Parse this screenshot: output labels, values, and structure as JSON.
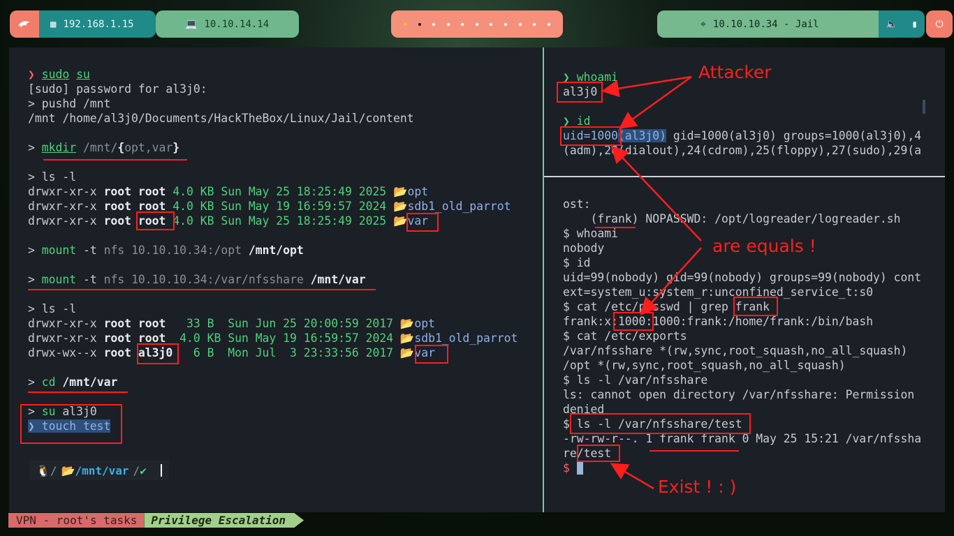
{
  "topbar": {
    "lan_ip": "192.168.1.15",
    "vpn_ip": "10.10.14.14",
    "target": "10.10.10.34 - Jail",
    "workspaces": [
      true,
      true,
      false,
      false,
      false,
      false,
      false,
      false,
      false,
      false,
      false
    ]
  },
  "left_pane": {
    "lines": [
      {
        "segs": [
          [
            "pink",
            "❯ "
          ],
          [
            "g u",
            "sudo"
          ],
          [
            "c",
            " "
          ],
          [
            "g u",
            "su"
          ]
        ]
      },
      {
        "segs": [
          [
            "c",
            "[sudo] password for al3j0:"
          ]
        ]
      },
      {
        "segs": [
          [
            "c",
            "> pushd /mnt"
          ]
        ]
      },
      {
        "segs": [
          [
            "c",
            "/mnt /home/al3j0/Documents/HackTheBox/Linux/Jail/content"
          ]
        ]
      },
      {
        "segs": [
          [
            "c",
            ""
          ]
        ]
      },
      {
        "segs": [
          [
            "c",
            "> "
          ],
          [
            "g u",
            "mkdir"
          ],
          [
            "c",
            " "
          ],
          [
            "gr",
            "/mnt/"
          ],
          [
            "w",
            "{"
          ],
          [
            "gr",
            "opt,var"
          ],
          [
            "w",
            "}"
          ]
        ]
      },
      {
        "segs": [
          [
            "c",
            ""
          ]
        ]
      },
      {
        "segs": [
          [
            "c",
            "> ls -l"
          ]
        ]
      },
      {
        "segs": [
          [
            "c",
            "drwxr-xr-x "
          ],
          [
            "w",
            "root root"
          ],
          [
            "c",
            " "
          ],
          [
            "g",
            "4.0 KB"
          ],
          [
            "c",
            " "
          ],
          [
            "g",
            "Sun May 25 18:25:49 2025"
          ],
          [
            "b",
            " 📂opt"
          ]
        ]
      },
      {
        "segs": [
          [
            "c",
            "drwxr-xr-x "
          ],
          [
            "w",
            "root root"
          ],
          [
            "c",
            " "
          ],
          [
            "g",
            "4.0 KB"
          ],
          [
            "c",
            " "
          ],
          [
            "g",
            "Sun May 19 16:59:57 2024"
          ],
          [
            "b",
            " 📂sdb1_old_parrot"
          ]
        ]
      },
      {
        "segs": [
          [
            "c",
            "drwxr-xr-x "
          ],
          [
            "w",
            "root root"
          ],
          [
            "c",
            " "
          ],
          [
            "g",
            "4.0 KB"
          ],
          [
            "c",
            " "
          ],
          [
            "g",
            "Sun May 25 18:25:49 2025"
          ],
          [
            "b",
            " 📂var"
          ]
        ]
      },
      {
        "segs": [
          [
            "c",
            ""
          ]
        ]
      },
      {
        "segs": [
          [
            "c",
            "> "
          ],
          [
            "g",
            "mount"
          ],
          [
            "c",
            " -t "
          ],
          [
            "gr",
            "nfs"
          ],
          [
            "c",
            " "
          ],
          [
            "gr",
            "10.10.10.34:/opt"
          ],
          [
            "c",
            " "
          ],
          [
            "w",
            "/mnt/opt"
          ]
        ]
      },
      {
        "segs": [
          [
            "c",
            ""
          ]
        ]
      },
      {
        "segs": [
          [
            "c",
            "> "
          ],
          [
            "g",
            "mount"
          ],
          [
            "c",
            " -t "
          ],
          [
            "gr",
            "nfs"
          ],
          [
            "c",
            " "
          ],
          [
            "gr",
            "10.10.10.34:/var/nfsshare"
          ],
          [
            "c",
            " "
          ],
          [
            "w",
            "/mnt/var"
          ]
        ]
      },
      {
        "segs": [
          [
            "c",
            ""
          ]
        ]
      },
      {
        "segs": [
          [
            "c",
            "> ls -l"
          ]
        ]
      },
      {
        "segs": [
          [
            "c",
            "drwxr-xr-x "
          ],
          [
            "w",
            "root root"
          ],
          [
            "c",
            "   "
          ],
          [
            "g",
            "33 B "
          ],
          [
            "c",
            " "
          ],
          [
            "g",
            "Sun Jun 25 20:00:59 2017"
          ],
          [
            "b",
            " 📂opt"
          ]
        ]
      },
      {
        "segs": [
          [
            "c",
            "drwxr-xr-x "
          ],
          [
            "w",
            "root root"
          ],
          [
            "c",
            "  "
          ],
          [
            "g",
            "4.0 KB"
          ],
          [
            "c",
            " "
          ],
          [
            "g",
            "Sun May 19 16:59:57 2024"
          ],
          [
            "b",
            " 📂sdb1_old_parrot"
          ]
        ]
      },
      {
        "segs": [
          [
            "c",
            "drwx-wx--x "
          ],
          [
            "w",
            "root al3j0"
          ],
          [
            "c",
            "   "
          ],
          [
            "g",
            "6 B "
          ],
          [
            "c",
            " "
          ],
          [
            "g",
            "Mon Jul  3 23:33:56 2017"
          ],
          [
            "b",
            " 📂var"
          ]
        ]
      },
      {
        "segs": [
          [
            "c",
            ""
          ]
        ]
      },
      {
        "segs": [
          [
            "c",
            "> "
          ],
          [
            "g",
            "cd"
          ],
          [
            "c",
            " "
          ],
          [
            "w",
            "/mnt/var"
          ]
        ]
      },
      {
        "segs": [
          [
            "c",
            ""
          ]
        ]
      },
      {
        "segs": [
          [
            "c",
            "> "
          ],
          [
            "g",
            "su"
          ],
          [
            "c",
            " al3j0"
          ]
        ]
      },
      {
        "segs": [
          [
            "hl b",
            "❯ touch test"
          ]
        ]
      }
    ],
    "prompt_path": "/mnt/var",
    "prompt_check": "✔"
  },
  "right_top": {
    "lines": [
      {
        "segs": [
          [
            "g",
            "❯ "
          ],
          [
            "g",
            "whoami"
          ]
        ]
      },
      {
        "segs": [
          [
            "c",
            "al3j0"
          ]
        ]
      },
      {
        "segs": [
          [
            "c",
            ""
          ]
        ]
      },
      {
        "segs": [
          [
            "g",
            "❯ "
          ],
          [
            "g",
            "id"
          ]
        ]
      },
      {
        "segs": [
          [
            "b",
            "uid=1000"
          ],
          [
            "hl b",
            "(al3j0)"
          ],
          [
            "c",
            " gid=1000(al3j0) groups=1000(al3j0),4"
          ]
        ]
      },
      {
        "segs": [
          [
            "c",
            "(adm),20(dialout),24(cdrom),25(floppy),27(sudo),29(a"
          ]
        ]
      }
    ]
  },
  "right_bottom": {
    "lines": [
      {
        "segs": [
          [
            "c",
            "ost:"
          ]
        ]
      },
      {
        "segs": [
          [
            "c",
            "    (frank) NOPASSWD: /opt/logreader/logreader.sh"
          ]
        ]
      },
      {
        "segs": [
          [
            "c",
            "$ whoami"
          ]
        ]
      },
      {
        "segs": [
          [
            "c",
            "nobody"
          ]
        ]
      },
      {
        "segs": [
          [
            "c",
            "$ id"
          ]
        ]
      },
      {
        "segs": [
          [
            "c",
            "uid=99(nobody) gid=99(nobody) groups=99(nobody) cont"
          ]
        ]
      },
      {
        "segs": [
          [
            "c",
            "ext=system_u:system_r:unconfined_service_t:s0"
          ]
        ]
      },
      {
        "segs": [
          [
            "c",
            "$ cat /etc/passwd | grep frank"
          ]
        ]
      },
      {
        "segs": [
          [
            "c",
            "frank:x:1000:1000:frank:/home/frank:/bin/bash"
          ]
        ]
      },
      {
        "segs": [
          [
            "c",
            "$ cat /etc/exports"
          ]
        ]
      },
      {
        "segs": [
          [
            "c",
            "/var/nfsshare *(rw,sync,root_squash,no_all_squash)"
          ]
        ]
      },
      {
        "segs": [
          [
            "c",
            "/opt *(rw,sync,root_squash,no_all_squash)"
          ]
        ]
      },
      {
        "segs": [
          [
            "c",
            "$ ls -l /var/nfsshare"
          ]
        ]
      },
      {
        "segs": [
          [
            "c",
            "ls: cannot open directory /var/nfsshare: Permission"
          ]
        ]
      },
      {
        "segs": [
          [
            "c",
            "denied"
          ]
        ]
      },
      {
        "segs": [
          [
            "c",
            "$ ls -l /var/nfsshare/test"
          ]
        ]
      },
      {
        "segs": [
          [
            "c",
            "-rw-rw-r--. 1 frank frank 0 May 25 15:21 /var/nfssha"
          ]
        ]
      },
      {
        "segs": [
          [
            "c",
            "re/test"
          ]
        ]
      },
      {
        "segs": [
          [
            "pink",
            "$ "
          ]
        ]
      }
    ]
  },
  "annotations": {
    "attacker": "Attacker",
    "equals": "are equals !",
    "exist": "Exist !   : )"
  },
  "statusbar": {
    "session": "VPN - root's tasks",
    "window": "Privilege Escalation"
  }
}
